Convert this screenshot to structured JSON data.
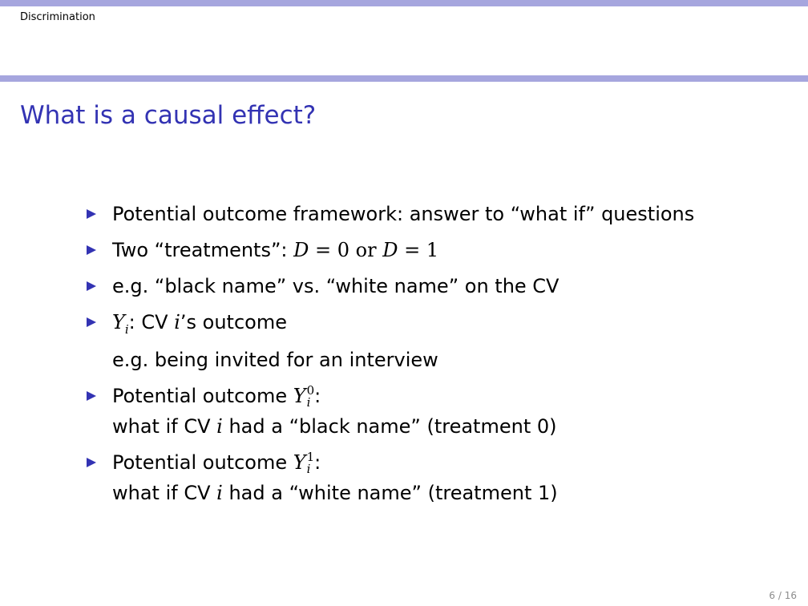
{
  "header": {
    "section": "Discrimination"
  },
  "title": "What is a causal effect?",
  "bullets": [
    {
      "text": "Potential outcome framework: answer to “what if” questions"
    },
    {
      "pre": "Two “treatments”: ",
      "var1": "D",
      "eq1": " = 0 or ",
      "var2": "D",
      "eq2": " = 1"
    },
    {
      "text": "e.g. “black name” vs. “white name” on the CV"
    },
    {
      "var": "Y",
      "sub": "i",
      "line1_rest": ": CV ",
      "var_i": "i",
      "line1_tail": "’s outcome",
      "line2": "e.g. being invited for an interview"
    },
    {
      "label": "Potential outcome ",
      "var": "Y",
      "sup": "0",
      "sub": "i",
      "colon": ":",
      "line2_pre": "what if CV ",
      "var_i": "i",
      "line2_post": " had a “black name” (treatment 0)"
    },
    {
      "label": "Potential outcome ",
      "var": "Y",
      "sup": "1",
      "sub": "i",
      "colon": ":",
      "line2_pre": "what if CV ",
      "var_i": "i",
      "line2_post": " had a “white name” (treatment 1)"
    }
  ],
  "footer": {
    "page": "6 / 16"
  },
  "colors": {
    "bar": "#a6a6de",
    "title": "#3333b3",
    "marker": "#3333b3",
    "page_number": "#8c8c8c"
  }
}
